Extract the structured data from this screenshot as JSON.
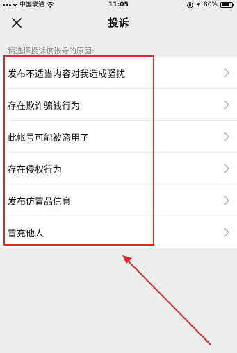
{
  "status_bar": {
    "carrier": "中国联通",
    "time": "11:05",
    "battery": "80%"
  },
  "nav": {
    "title": "投诉"
  },
  "prompt": "请选择投诉该帐号的原因:",
  "reasons": [
    "发布不适当内容对我造成骚扰",
    "存在欺诈骗钱行为",
    "此帐号可能被盗用了",
    "存在侵权行为",
    "发布仿冒品信息",
    "冒充他人"
  ],
  "icons": {
    "close": "close-icon",
    "chevron": "chevron-right-icon",
    "wifi": "wifi-icon",
    "battery": "battery-icon"
  },
  "colors": {
    "page_bg": "#ededed",
    "list_bg": "#ffffff",
    "annotation_red": "#e0262d",
    "hint_text": "#8c8c8c"
  }
}
